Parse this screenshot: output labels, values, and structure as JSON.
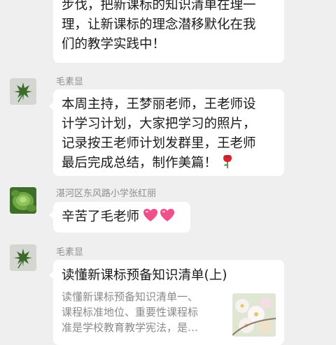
{
  "messages": [
    {
      "lines": [
        "步伐，把新课标的知识清单在理一",
        "理，让新课标的理念潜移默化在我",
        "们的教学实践中！"
      ]
    },
    {
      "sender": "毛素显",
      "avatar": "maple-leaf-icon",
      "lines": [
        "本周主持，王梦丽老师，王老师设",
        "计学习计划，大家把学习的照片，",
        "记录按王老师计划发群里，王老师",
        "最后完成总结，制作美篇！"
      ],
      "emoji": "rose-icon"
    },
    {
      "sender": "湛河区东风路小学张红丽",
      "avatar": "succulent-icon",
      "text": "辛苦了毛老师",
      "emoji": "two-hearts-icon"
    },
    {
      "sender": "毛素显",
      "avatar": "maple-leaf-icon",
      "card": {
        "title": "读懂新课标预备知识清单(上)",
        "desc_lines": [
          "读懂新课标预备知识清单一、",
          "课程标准地位、重要性课程标",
          "准是学校教育教学宪法，是…"
        ],
        "thumbnail": "blossom-image"
      }
    }
  ],
  "colors": {
    "background": "#efefef",
    "bubble": "#ffffff",
    "sender": "#8e8e8e",
    "heart": "#f0508a"
  }
}
